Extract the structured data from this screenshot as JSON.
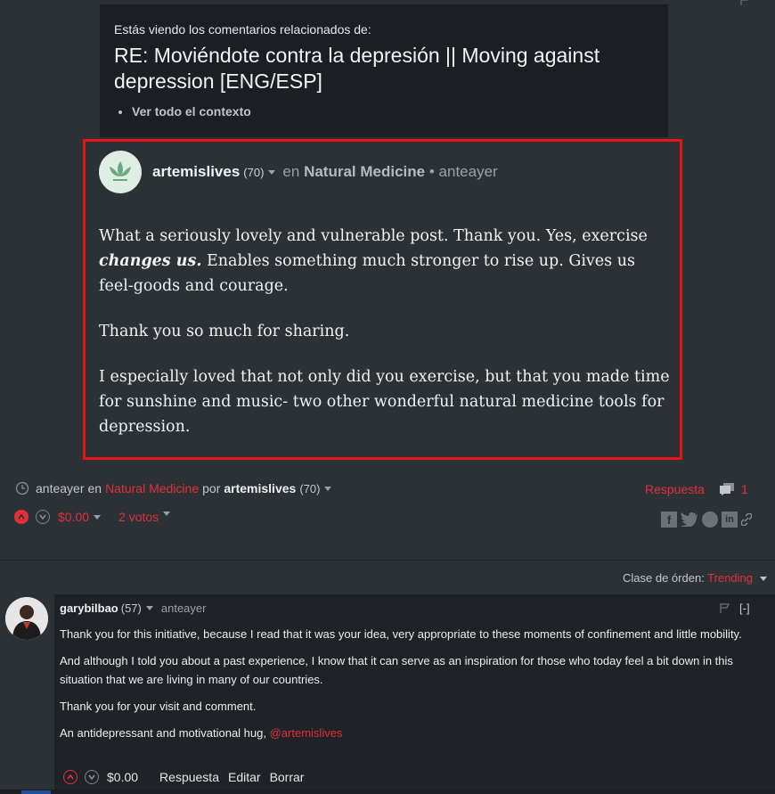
{
  "context": {
    "lead": "Estás viendo los comentarios relacionados de:",
    "title": "RE: Moviéndote contra la depresión || Moving against depression [ENG/ESP]",
    "link": "Ver todo el contexto"
  },
  "comment": {
    "author": "artemislives",
    "reputation": "(70)",
    "in_label": "en",
    "community": "Natural Medicine",
    "separator": "•",
    "time": "anteayer",
    "p1_before": "What a seriously lovely and vulnerable post. Thank you. Yes, exercise ",
    "p1_emph": "changes us.",
    "p1_after": " Enables something much stronger to rise up. Gives us feel-goods and courage.",
    "p2": "Thank you so much for sharing.",
    "p3": "I especially loved that not only did you exercise, but that you made time for sunshine and music- two other wonderful natural medicine tools for depression."
  },
  "footer": {
    "time": "anteayer",
    "in_label": "en",
    "community": "Natural Medicine",
    "by_label": "por",
    "author": "artemislives",
    "reputation": "(70)",
    "reply_label": "Respuesta",
    "reply_count": "1",
    "payout": "$0.00",
    "votes": "2 votos"
  },
  "sort": {
    "label": "Clase de órden:",
    "value": "Trending"
  },
  "reply": {
    "author": "garybilbao",
    "reputation": "(57)",
    "time": "anteayer",
    "collapse": "[-]",
    "p1": "Thank you for this initiative, because I read that it was your idea, very appropriate to these moments of confinement and little mobility.",
    "p2": "And although I told you about a past experience, I know that it can serve as an inspiration for those who today feel a bit down in this situation that we are living in many of our countries.",
    "p3": "Thank you for your visit and comment.",
    "p4_before": "An antidepressant and motivational hug, ",
    "mention": "@artemislives",
    "payout": "$0.00",
    "actions": [
      "Respuesta",
      "Editar",
      "Borrar"
    ]
  },
  "colors": {
    "accent": "#e0313b",
    "highlight_border": "#e31414",
    "background": "#2c3136"
  }
}
